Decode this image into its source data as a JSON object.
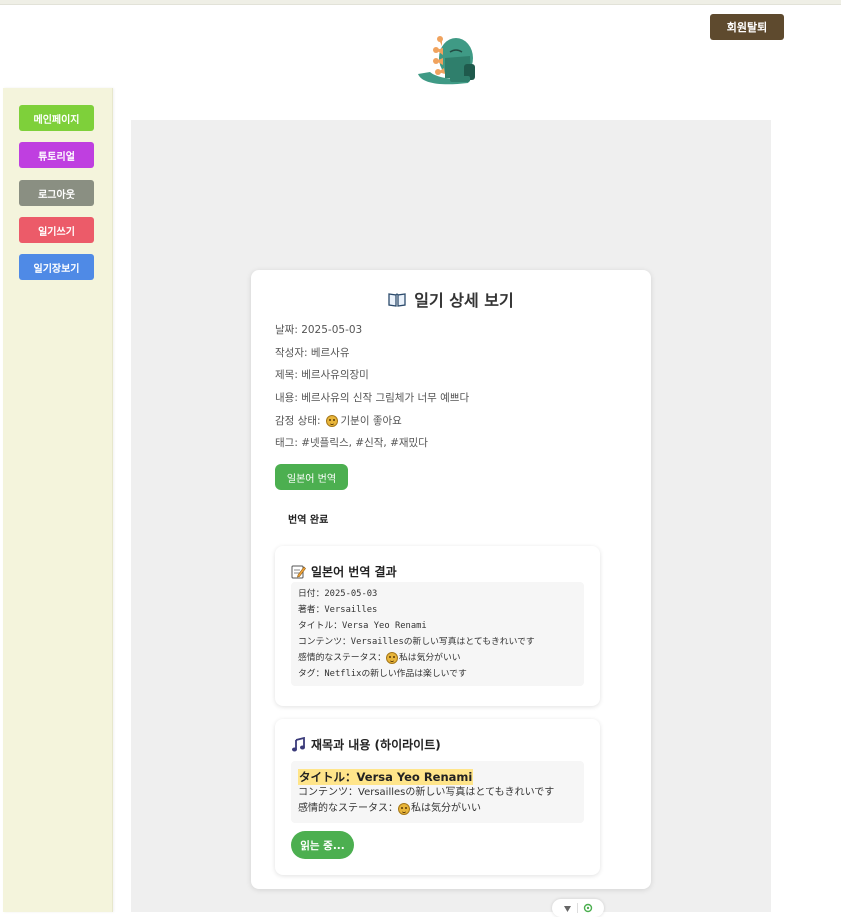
{
  "header": {
    "withdraw_label": "회원탈퇴",
    "logo_icon": "dinosaur-mascot-icon"
  },
  "sidebar": {
    "items": [
      {
        "label": "메인페이지",
        "color": "#7ed03a"
      },
      {
        "label": "튜토리얼",
        "color": "#bf3fe0"
      },
      {
        "label": "로그아웃",
        "color": "#8a8f82"
      },
      {
        "label": "일기쓰기",
        "color": "#ec5b69"
      },
      {
        "label": "일기장보기",
        "color": "#4f8ae6"
      }
    ]
  },
  "detail": {
    "title_icon": "open-book-icon",
    "title": "일기 상세 보기",
    "date": "날짜: 2025-05-03",
    "author": "작성자: 베르사유",
    "subject": "제목: 베르사유의장미",
    "content": "내용: 베르사유의 신작 그림체가 너무 예쁘다",
    "emotion_label": "감정 상태:",
    "emotion_icon": "grinning-face-icon",
    "emotion_text": "기분이 좋아요",
    "tags": "태그: #넷플릭스, #신작, #재밌다",
    "translate_button": "일본어 번역",
    "status": "번역 완료"
  },
  "translation": {
    "icon": "memo-icon",
    "title": "일본어 번역 결과",
    "lines": [
      "日付：2025-05-03",
      "著者：Versailles",
      "タイトル：Versa Yeo Renami",
      "コンテンツ：Versaillesの新しい写真はとてもきれいです"
    ],
    "emotion_prefix": "感情的なステータス：",
    "emotion_suffix": "私は気分がいい",
    "tag_line": "タグ：Netflixの新しい作品は楽しいです"
  },
  "highlight": {
    "icon": "music-note-icon",
    "title": "재목과 내용 (하이라이트)",
    "highlight_title": "タイトル：Versa Yeo Renami",
    "content": "コンテンツ：Versaillesの新しい写真はとてもきれいです",
    "emotion_prefix": "感情的なステータス：",
    "emotion_suffix": "私は気分がいい",
    "reading_button": "읽는 중..."
  },
  "toolbar": {
    "icons": [
      "chevron-down-icon",
      "gear-icon"
    ]
  },
  "colors": {
    "accent_green": "#4caf50",
    "highlight_yellow": "#ffe58a",
    "withdraw_brown": "#5e4a2e",
    "sidebar_bg": "#f4f4dc"
  }
}
